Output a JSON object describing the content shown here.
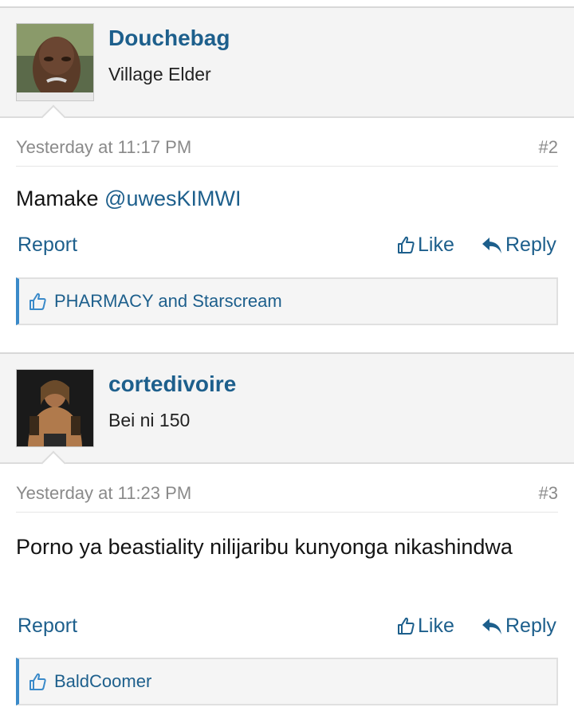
{
  "posts": [
    {
      "username": "Douchebag",
      "user_title": "Village Elder",
      "date": "Yesterday at 11:17 PM",
      "post_number": "#2",
      "message_text": "Mamake ",
      "mention": "@uwesKIMWI",
      "report_label": "Report",
      "like_label": "Like",
      "reply_label": "Reply",
      "liked_by": "PHARMACY and Starscream"
    },
    {
      "username": "cortedivoire",
      "user_title": "Bei ni 150",
      "date": "Yesterday at 11:23 PM",
      "post_number": "#3",
      "message_text": "Porno ya beastiality nilijaribu kunyonga nikashindwa",
      "report_label": "Report",
      "like_label": "Like",
      "reply_label": "Reply",
      "liked_by": "BaldCoomer"
    }
  ],
  "colors": {
    "link": "#1d5f8c",
    "like_bar_accent": "#3a8ac9",
    "header_bg": "#f4f4f4"
  },
  "icons": {
    "like": "thumbs-up-icon",
    "reply": "reply-arrow-icon"
  }
}
